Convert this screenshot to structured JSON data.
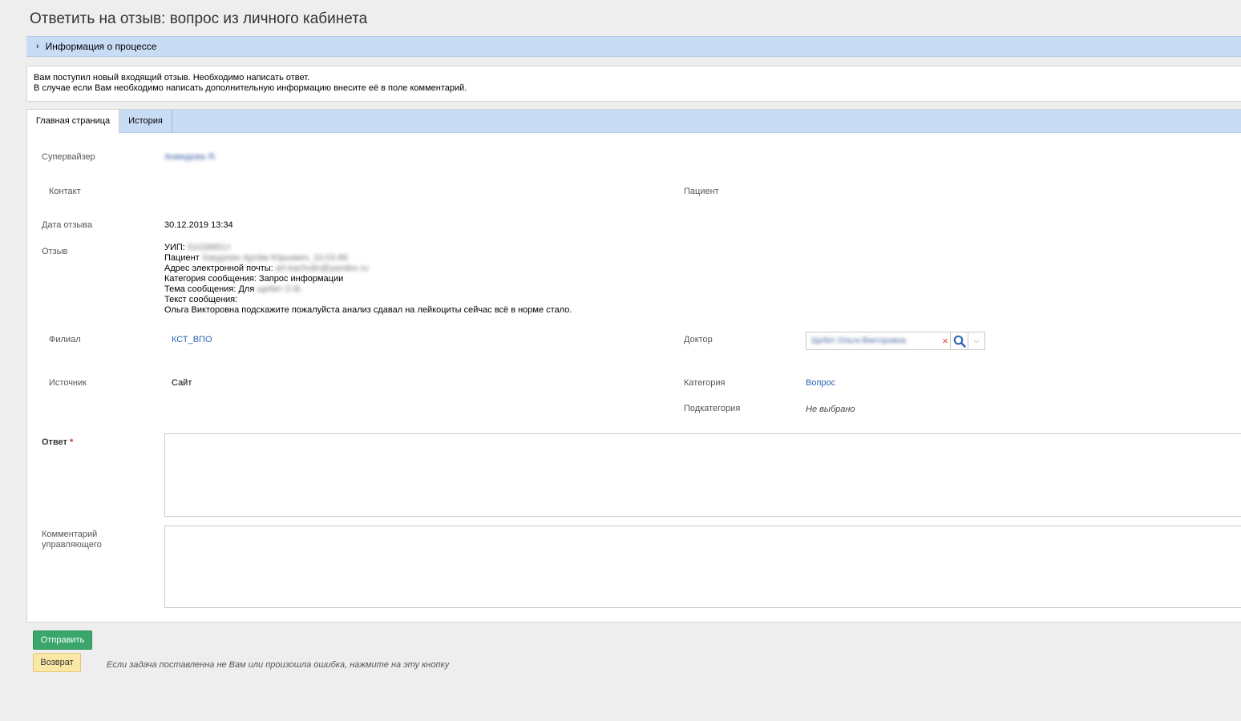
{
  "page": {
    "title": "Ответить на отзыв: вопрос из личного кабинета"
  },
  "process_info": {
    "label": "Информация о процессе"
  },
  "info": {
    "line1": "Вам поступил новый входящий отзыв. Необходимо написать ответ.",
    "line2": "В случае если Вам необходимо написать дополнительную информацию внесите её в поле комментарий."
  },
  "tabs": [
    {
      "label": "Главная страница",
      "active": true
    },
    {
      "label": "История",
      "active": false
    }
  ],
  "form": {
    "supervisor": {
      "label": "Супервайзер",
      "value": "Анмедова Я."
    },
    "contact": {
      "label": "Контакт"
    },
    "patient": {
      "label": "Пациент"
    },
    "date": {
      "label": "Дата отзыва",
      "value": "30.12.2019 13:34"
    },
    "feedback": {
      "label": "Отзыв",
      "uip_prefix": "УИП:",
      "uip_value": "51028851т",
      "patient_prefix": "Пациент",
      "patient_value": "Хакурлин Артём Юрьевич, 10.03.86",
      "email_prefix": "Адрес электронной почты:",
      "email_value": "art.kachulin@yandex.ru",
      "category_line": "Категория сообщения: Запрос информации",
      "topic_prefix": "Тема сообщения: Для",
      "topic_value": "щебет О.В.",
      "text_prefix": "Текст сообщения:",
      "text_body": "Ольга Викторовна подскажите пожалуйста анализ сдавал на лейкоциты сейчас всё в норме стало."
    },
    "branch": {
      "label": "Филиал",
      "value": "КСТ_ВПО"
    },
    "doctor": {
      "label": "Доктор",
      "value": "Щебет Ольга Викторовна"
    },
    "source": {
      "label": "Источник",
      "value": "Сайт"
    },
    "category": {
      "label": "Категория",
      "value": "Вопрос"
    },
    "subcategory": {
      "label": "Подкатегория",
      "value": "Не выбрано"
    },
    "answer": {
      "label": "Ответ",
      "required_mark": "*",
      "value": ""
    },
    "manager_comment": {
      "label_line1": "Комментарий",
      "label_line2": "управляющего",
      "value": ""
    }
  },
  "buttons": {
    "send": "Отправить",
    "return": "Возврат",
    "return_hint": "Если задача поставленна не Вам или произошла ошибка, нажмите на эту кнопку"
  },
  "colors": {
    "header_bar": "#c9dcf6",
    "send_button": "#3aa66a",
    "return_button": "#fbe8a6",
    "link": "#2a64b8"
  }
}
